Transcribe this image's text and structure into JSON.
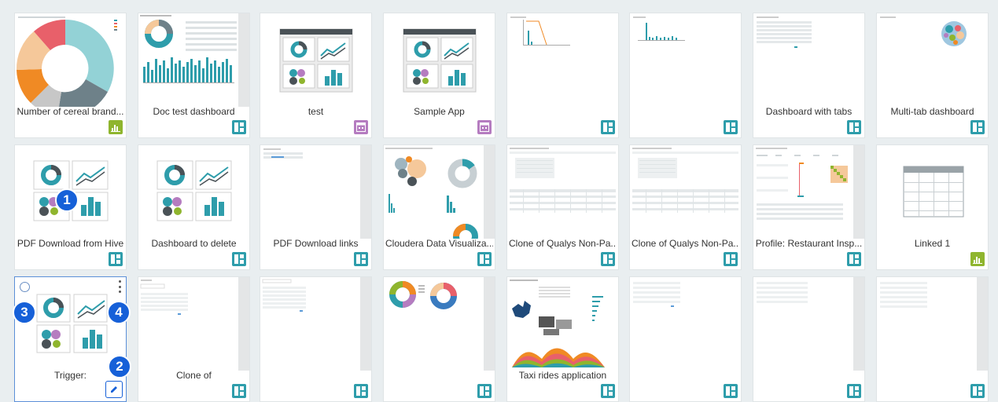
{
  "colors": {
    "teal": "#2e9dab",
    "green": "#8fb52e",
    "purple": "#b57cc0",
    "callout": "#1660d8"
  },
  "cards": [
    {
      "title": "Number of cereal brand...",
      "badge": "bar-chart-icon"
    },
    {
      "title": "Doc test dashboard",
      "badge": "dashboard-icon"
    },
    {
      "title": "test",
      "badge": "app-icon"
    },
    {
      "title": "Sample App",
      "badge": "app-icon"
    },
    {
      "title": "",
      "badge": "dashboard-icon"
    },
    {
      "title": "",
      "badge": "dashboard-icon"
    },
    {
      "title": "Dashboard with tabs",
      "badge": "dashboard-icon"
    },
    {
      "title": "Multi-tab dashboard",
      "badge": "dashboard-icon"
    },
    {
      "title": "PDF Download from Hive",
      "badge": "dashboard-icon"
    },
    {
      "title": "Dashboard to delete",
      "badge": "dashboard-icon"
    },
    {
      "title": "PDF Download links",
      "badge": "dashboard-icon"
    },
    {
      "title": "Cloudera Data Visualiza...",
      "badge": "dashboard-icon"
    },
    {
      "title": "Clone of Qualys Non-Pa...",
      "badge": "dashboard-icon"
    },
    {
      "title": "Clone of Qualys Non-Pa...",
      "badge": "dashboard-icon"
    },
    {
      "title": "Profile: Restaurant Insp...",
      "badge": "dashboard-icon"
    },
    {
      "title": "Linked 1",
      "badge": "bar-chart-icon"
    },
    {
      "title": "Trigger:",
      "badge": "edit-icon"
    },
    {
      "title": "Clone of",
      "badge": "dashboard-icon"
    },
    {
      "title": "",
      "badge": "dashboard-icon"
    },
    {
      "title": "",
      "badge": "dashboard-icon"
    },
    {
      "title": "Taxi rides application",
      "badge": "dashboard-icon"
    },
    {
      "title": "",
      "badge": "dashboard-icon"
    },
    {
      "title": "",
      "badge": "dashboard-icon"
    },
    {
      "title": "",
      "badge": "dashboard-icon"
    }
  ],
  "callouts": [
    "1",
    "2",
    "3",
    "4"
  ]
}
